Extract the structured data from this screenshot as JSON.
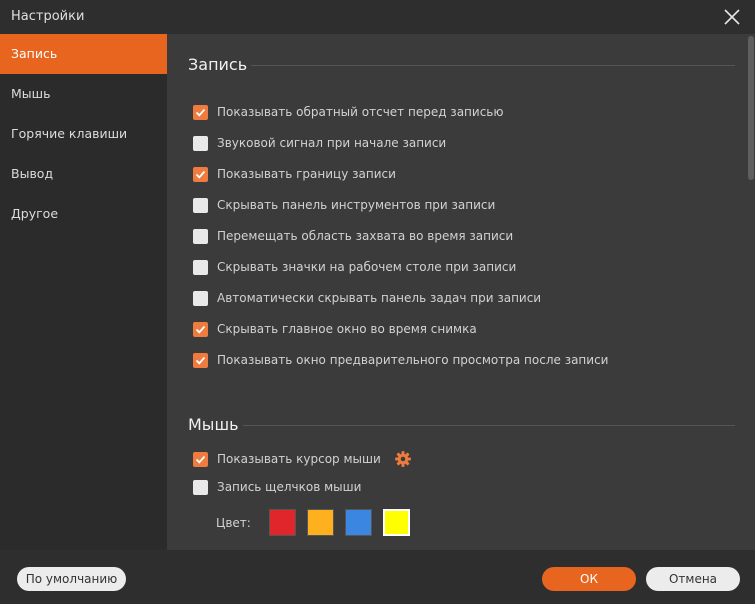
{
  "window": {
    "title": "Настройки"
  },
  "sidebar": {
    "items": [
      {
        "label": "Запись",
        "active": true
      },
      {
        "label": "Мышь",
        "active": false
      },
      {
        "label": "Горячие клавиши",
        "active": false
      },
      {
        "label": "Вывод",
        "active": false
      },
      {
        "label": "Другое",
        "active": false
      }
    ]
  },
  "recording": {
    "title": "Запись",
    "options": [
      {
        "label": "Показывать обратный отсчет перед записью",
        "checked": true
      },
      {
        "label": "Звуковой сигнал при начале записи",
        "checked": false
      },
      {
        "label": "Показывать границу записи",
        "checked": true
      },
      {
        "label": "Скрывать панель инструментов при записи",
        "checked": false
      },
      {
        "label": "Перемещать область захвата во время записи",
        "checked": false
      },
      {
        "label": "Скрывать значки на рабочем столе при записи",
        "checked": false
      },
      {
        "label": "Автоматически скрывать панель задач при записи",
        "checked": false
      },
      {
        "label": "Скрывать главное окно во время снимка",
        "checked": true
      },
      {
        "label": "Показывать окно предварительного просмотра после записи",
        "checked": true
      }
    ]
  },
  "mouse": {
    "title": "Мышь",
    "show_cursor": {
      "label": "Показывать курсор мыши",
      "checked": true
    },
    "record_clicks": {
      "label": "Запись щелчков мыши",
      "checked": false
    },
    "color_label": "Цвет:",
    "colors": [
      "#e0252b",
      "#ffb01e",
      "#3a86e0",
      "#ffff00"
    ],
    "selected_color": "#ffff00"
  },
  "footer": {
    "default_label": "По умолчанию",
    "ok_label": "ОК",
    "cancel_label": "Отмена"
  },
  "colors": {
    "accent": "#e8651f",
    "checkbox_checked": "#ef7b3f"
  }
}
